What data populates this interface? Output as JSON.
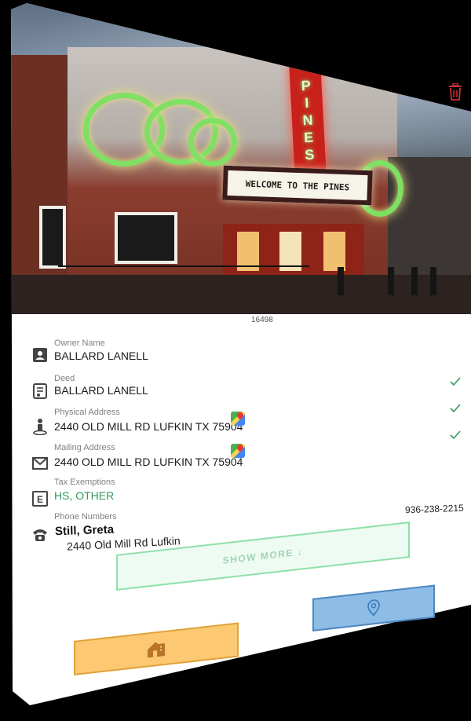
{
  "photo": {
    "marquee_text": "WELCOME TO THE PINES",
    "vertical_sign_letters": [
      "P",
      "I",
      "N",
      "E",
      "S"
    ],
    "caption": "16498"
  },
  "fields": {
    "owner": {
      "label": "Owner Name",
      "value": "BALLARD LANELL",
      "icon": "person-badge-icon"
    },
    "deed": {
      "label": "Deed",
      "value": "BALLARD LANELL",
      "icon": "certificate-icon"
    },
    "physical_address": {
      "label": "Physical Address",
      "value": "2440 OLD MILL RD LUFKIN TX 75904",
      "icon": "location-person-icon"
    },
    "mailing_address": {
      "label": "Mailing Address",
      "value": "2440 OLD MILL RD LUFKIN TX 75904",
      "icon": "envelope-icon"
    },
    "tax_exemptions": {
      "label": "Tax Exemptions",
      "value": "HS, OTHER",
      "icon": "letter-e-icon"
    },
    "phone_numbers": {
      "label": "Phone Numbers",
      "icon": "telephone-icon"
    }
  },
  "contact": {
    "name": "Still, Greta",
    "phone": "936-238-2215",
    "address": "2440 Old Mill Rd Lufkin"
  },
  "actions": {
    "show_more_label": "SHOW MORE ↓",
    "location_icon": "location-pin-icon",
    "property_icon": "property-building-icon"
  },
  "colors": {
    "accent_green": "#2e9a5e",
    "show_more_bg": "#eefbf3",
    "location_button_bg": "#8dbde6",
    "property_button_bg": "#fcc972",
    "trash_red": "#d32f2f"
  }
}
